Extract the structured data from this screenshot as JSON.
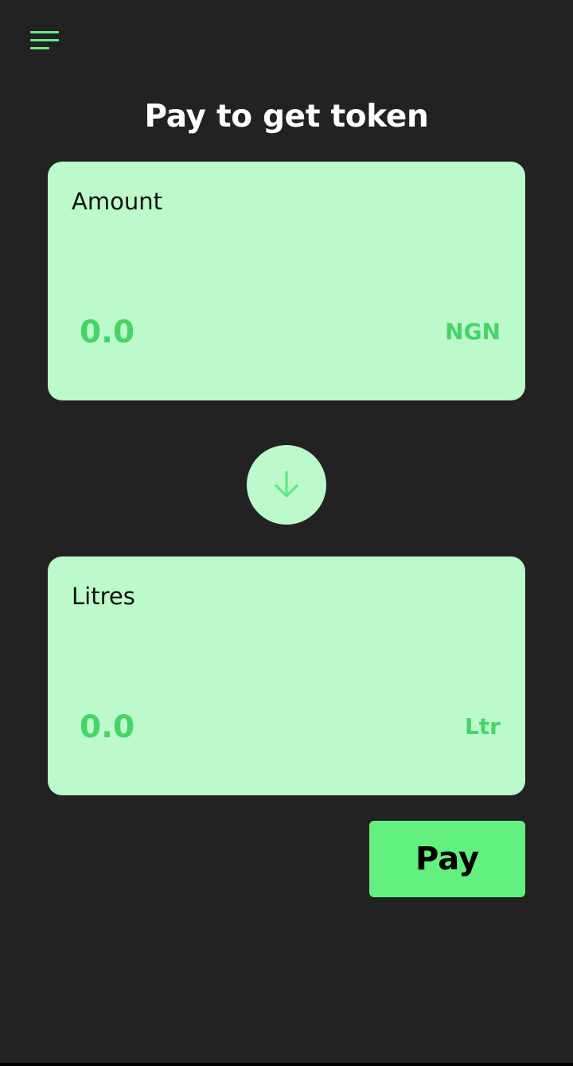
{
  "header": {
    "menu_icon": "hamburger-menu-icon",
    "accent_color": "#62f07e"
  },
  "title": "Pay to get token",
  "amount_card": {
    "label": "Amount",
    "value": "0.0",
    "unit": "NGN"
  },
  "swap": {
    "icon": "arrow-down-icon"
  },
  "litres_card": {
    "label": "Litres",
    "value": "0.0",
    "unit": "Ltr"
  },
  "pay_button": {
    "label": "Pay"
  },
  "colors": {
    "background": "#222222",
    "card": "#bcf9cb",
    "value_text": "#46d466",
    "button": "#62f07e"
  }
}
